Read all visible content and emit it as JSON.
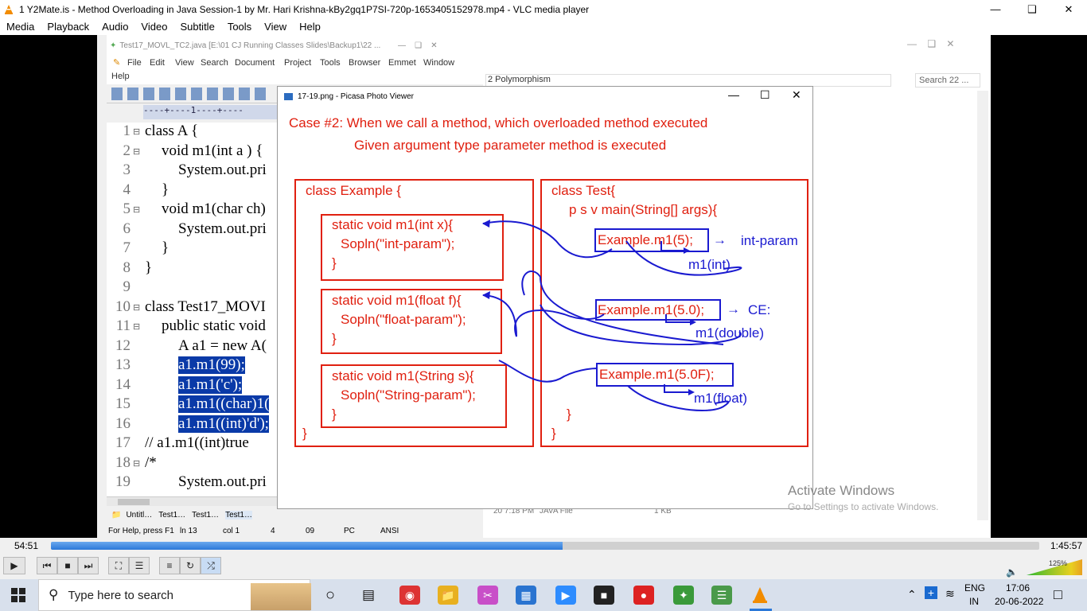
{
  "vlc": {
    "title": "1 Y2Mate.is - Method Overloading in Java  Session-1  by Mr. Hari Krishna-kBy2gq1P7SI-720p-1653405152978.mp4 - VLC media player",
    "menu": [
      "Media",
      "Playback",
      "Audio",
      "Video",
      "Subtitle",
      "Tools",
      "View",
      "Help"
    ],
    "elapsed": "54:51",
    "total": "1:45:57",
    "progress_fraction": 0.518,
    "volume_label": "125%",
    "accent_color": "#2b78d8"
  },
  "npp": {
    "title": "Test17_MOVL_TC2.java [E:\\01 CJ Running Classes Slides\\Backup1\\22 ...",
    "menu": [
      "File",
      "Edit",
      "View",
      "Search",
      "Document",
      "Project",
      "Tools",
      "Browser",
      "Emmet",
      "Window",
      "Help"
    ],
    "ruler": "----+----1----+----",
    "lines": [
      {
        "n": "1",
        "fold": "⊟",
        "indent": 0,
        "text": "class A {",
        "sel": false
      },
      {
        "n": "2",
        "fold": "⊟",
        "indent": 1,
        "text": "void m1(int a ) {",
        "sel": false
      },
      {
        "n": "3",
        "fold": "",
        "indent": 2,
        "text": "System.out.pri",
        "sel": false
      },
      {
        "n": "4",
        "fold": "",
        "indent": 1,
        "text": "}",
        "sel": false
      },
      {
        "n": "5",
        "fold": "⊟",
        "indent": 1,
        "text": "void m1(char ch)",
        "sel": false
      },
      {
        "n": "6",
        "fold": "",
        "indent": 2,
        "text": "System.out.pri",
        "sel": false
      },
      {
        "n": "7",
        "fold": "",
        "indent": 1,
        "text": "}",
        "sel": false
      },
      {
        "n": "8",
        "fold": "",
        "indent": 0,
        "text": "}",
        "sel": false
      },
      {
        "n": "9",
        "fold": "",
        "indent": 0,
        "text": "",
        "sel": false
      },
      {
        "n": "10",
        "fold": "⊟",
        "indent": 0,
        "text": "class Test17_MOVI",
        "sel": false
      },
      {
        "n": "11",
        "fold": "⊟",
        "indent": 1,
        "text": "public static void",
        "sel": false
      },
      {
        "n": "12",
        "fold": "",
        "indent": 2,
        "text": "A a1 = new A(",
        "sel": false
      },
      {
        "n": "13",
        "fold": "",
        "indent": 2,
        "text": "a1.m1(99);",
        "sel": true
      },
      {
        "n": "14",
        "fold": "",
        "indent": 2,
        "text": "a1.m1('c');",
        "sel": true
      },
      {
        "n": "15",
        "fold": "",
        "indent": 2,
        "text": "a1.m1((char)1(",
        "sel": true
      },
      {
        "n": "16",
        "fold": "",
        "indent": 2,
        "text": "a1.m1((int)'d');",
        "sel": true
      },
      {
        "n": "17",
        "fold": "",
        "indent": 0,
        "text": "//     a1.m1((int)true",
        "sel": false
      },
      {
        "n": "18",
        "fold": "⊟",
        "indent": 0,
        "text": "/*",
        "sel": false
      },
      {
        "n": "19",
        "fold": "",
        "indent": 2,
        "text": "System.out.pri",
        "sel": false
      }
    ],
    "tabs": [
      "Untitl…",
      "Test1…",
      "Test1…",
      "Test1…"
    ],
    "status": [
      "For Help, press F1",
      "ln 13",
      "col 1",
      "4",
      "09",
      "PC",
      "ANSI"
    ]
  },
  "explorer": {
    "breadcrumb": "2 Polymorphism",
    "search_placeholder": "Search 22 ...",
    "file_date": "20 7:18 PM",
    "file_type": "JAVA File",
    "file_size": "1 KB"
  },
  "picasa": {
    "title": "17-19.png - Picasa Photo Viewer",
    "heading1": "Case #2: When we call a method, which overloaded method executed",
    "heading2": "Given argument type parameter method is executed",
    "example_class": "class Example {",
    "m_int": "static void m1(int x){",
    "m_int_body": "Sopln(\"int-param\");",
    "m_float": "static void m1(float f){",
    "m_float_body": "Sopln(\"float-param\");",
    "m_string": "static void m1(String s){",
    "m_string_body": "Sopln(\"String-param\");",
    "close_brace": "}",
    "test_class": "class Test{",
    "main": "p s v main(String[] args){",
    "call1": "Example.m1(5);",
    "call1_result": "int-param",
    "call1_target": "m1(int)",
    "call2": "Example.m1(5.0);",
    "call2_result": "CE:",
    "call2_target": "m1(double)",
    "call3": "Example.m1(5.0F);",
    "call3_target": "m1(float)",
    "red": "#e02010",
    "blue": "#1a1ad0"
  },
  "watermark": {
    "line1": "Activate Windows",
    "line2": "Go to Settings to activate Windows."
  },
  "taskbar": {
    "search_placeholder": "Type here to search",
    "lang1": "ENG",
    "lang2": "IN",
    "time": "17:06",
    "date": "20-06-2022"
  }
}
